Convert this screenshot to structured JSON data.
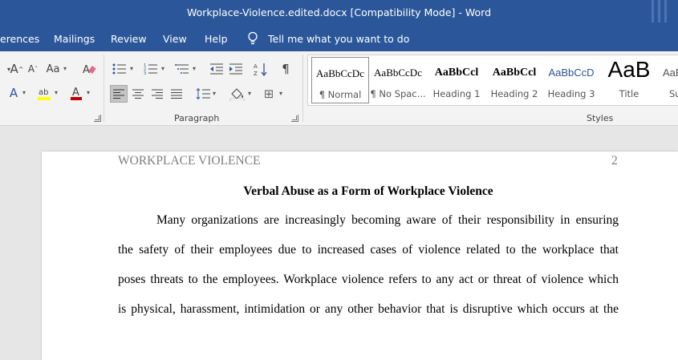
{
  "window": {
    "title": "Workplace-Violence.edited.docx [Compatibility Mode]  -  Word"
  },
  "tabs": {
    "references": "erences",
    "mailings": "Mailings",
    "review": "Review",
    "view": "View",
    "help": "Help",
    "tell_me": "Tell me what you want to do"
  },
  "ribbon": {
    "paragraph_label": "Paragraph",
    "styles_label": "Styles",
    "font_case": "Aa",
    "borders": "⊞",
    "pilcrow": "¶",
    "styles": [
      {
        "sample": "AaBbCcDc",
        "name": "¶ Normal"
      },
      {
        "sample": "AaBbCcDc",
        "name": "¶ No Spac..."
      },
      {
        "sample": "AaBbCcl",
        "name": "Heading 1"
      },
      {
        "sample": "AaBbCcl",
        "name": "Heading 2"
      },
      {
        "sample": "AaBbCcD",
        "name": "Heading 3"
      },
      {
        "sample": "AaB",
        "name": "Title"
      },
      {
        "sample": "AaBl",
        "name": "Su"
      }
    ]
  },
  "document": {
    "header_left": "WORKPLACE VIOLENCE",
    "page_number": "2",
    "title": "Verbal Abuse as a Form of Workplace Violence",
    "lines": [
      "Many organizations are increasingly becoming aware of their responsibility in ensuring",
      "the safety of their employees due to increased cases of violence related to the workplace that",
      "poses threats to the employees. Workplace violence refers to any act or threat of violence which",
      "is physical, harassment, intimidation or any other behavior that is disruptive which occurs at the"
    ]
  },
  "colors": {
    "titlebar": "#2b579a",
    "ribbon": "#f3f3f3",
    "heading_blue": "#2f5496"
  }
}
